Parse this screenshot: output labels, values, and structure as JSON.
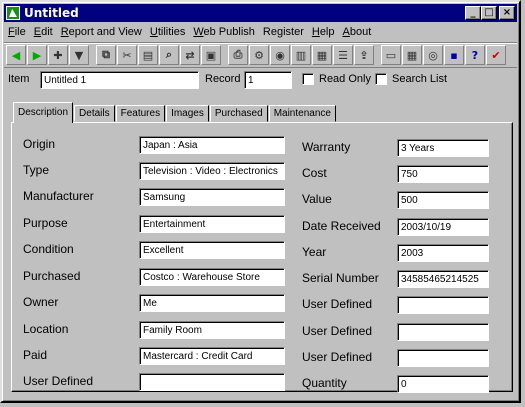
{
  "window": {
    "title": "Untitled"
  },
  "menu": [
    {
      "label": "File",
      "u": "F",
      "rest": "ile"
    },
    {
      "label": "Edit",
      "u": "E",
      "rest": "dit"
    },
    {
      "label": "Report and View",
      "u": "R",
      "rest": "eport and View"
    },
    {
      "label": "Utilities",
      "u": "U",
      "rest": "tilities"
    },
    {
      "label": "Web Publish",
      "u": "W",
      "rest": "eb Publish"
    },
    {
      "label": "Register",
      "u": "",
      "rest": "Register"
    },
    {
      "label": "Help",
      "u": "H",
      "rest": "elp"
    },
    {
      "label": "About",
      "u": "A",
      "rest": "bout"
    }
  ],
  "toolbar": {
    "icons": [
      "first-record-icon",
      "prev-record-icon",
      "add-record-icon",
      "delete-record-icon",
      "copy-icon",
      "cut-icon",
      "paste-icon",
      "find-icon",
      "replace-icon",
      "photo-icon",
      "print-icon",
      "print-setup-icon",
      "preview-icon",
      "chart-icon",
      "table-icon",
      "report-icon",
      "export-icon",
      "calculator-icon",
      "calendar-icon",
      "settings-icon",
      "save-icon",
      "help-icon",
      "check-icon"
    ]
  },
  "itembar": {
    "item_label": "Item",
    "item_value": "Untitled 1",
    "record_label": "Record",
    "record_value": "1",
    "read_only_label": "Read Only",
    "search_list_label": "Search List"
  },
  "tabs": [
    "Description",
    "Details",
    "Features",
    "Images",
    "Purchased",
    "Maintenance"
  ],
  "left_fields": [
    {
      "label": "Origin",
      "value": "Japan : Asia"
    },
    {
      "label": "Type",
      "value": "Television : Video : Electronics"
    },
    {
      "label": "Manufacturer",
      "value": "Samsung"
    },
    {
      "label": "Purpose",
      "value": "Entertainment"
    },
    {
      "label": "Condition",
      "value": "Excellent"
    },
    {
      "label": "Purchased",
      "value": "Costco : Warehouse Store"
    },
    {
      "label": "Owner",
      "value": "Me"
    },
    {
      "label": "Location",
      "value": "Family Room"
    },
    {
      "label": "Paid",
      "value": "Mastercard : Credit Card"
    },
    {
      "label": "User Defined",
      "value": ""
    }
  ],
  "right_fields": [
    {
      "label": "Warranty",
      "value": "3 Years"
    },
    {
      "label": "Cost",
      "value": "750"
    },
    {
      "label": "Value",
      "value": "500"
    },
    {
      "label": "Date Received",
      "value": "2003/10/19"
    },
    {
      "label": "Year",
      "value": "2003"
    },
    {
      "label": "Serial Number",
      "value": "34585465214525"
    },
    {
      "label": "User Defined",
      "value": ""
    },
    {
      "label": "User Defined",
      "value": ""
    },
    {
      "label": "User Defined",
      "value": ""
    },
    {
      "label": "Quantity",
      "value": "0"
    }
  ]
}
